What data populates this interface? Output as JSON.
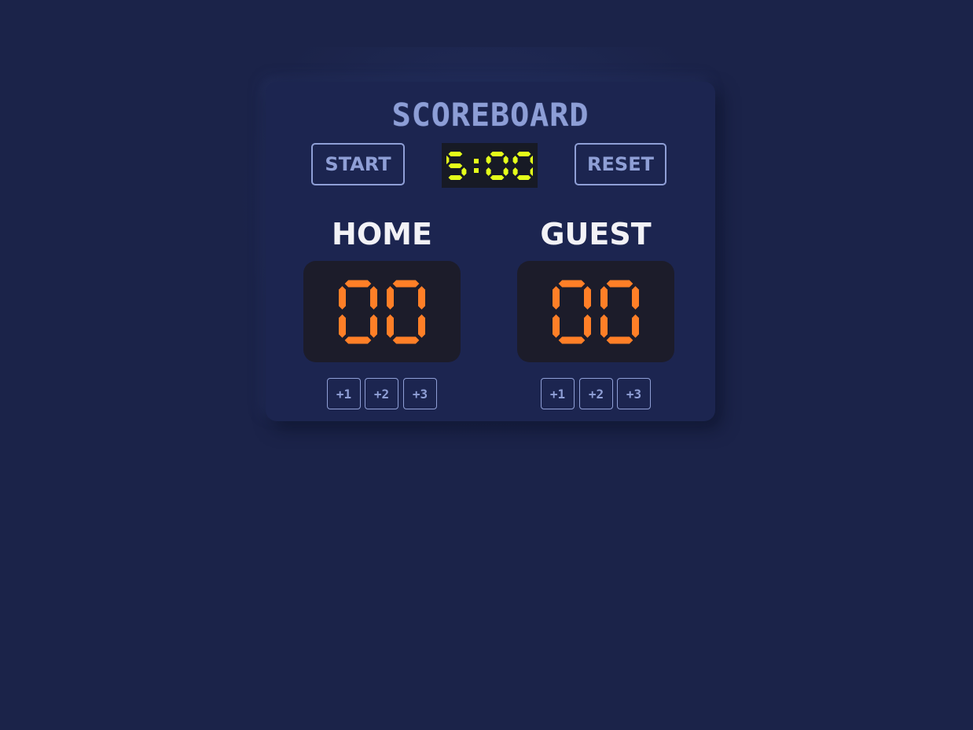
{
  "title": "SCOREBOARD",
  "controls": {
    "start_label": "START",
    "reset_label": "RESET",
    "timer": "5:00"
  },
  "teams": [
    {
      "name": "HOME",
      "score": "00",
      "buttons": [
        "+1",
        "+2",
        "+3"
      ]
    },
    {
      "name": "GUEST",
      "score": "00",
      "buttons": [
        "+1",
        "+2",
        "+3"
      ]
    }
  ],
  "colors": {
    "background": "#1b2349",
    "card": "#1c2550",
    "accent": "#8f9fd6",
    "timer_digits": "#e4ff1a",
    "score_digits": "#ff7f27",
    "team_name": "#f2f2f6"
  },
  "icons": {
    "start_button": "none",
    "reset_button": "none"
  }
}
